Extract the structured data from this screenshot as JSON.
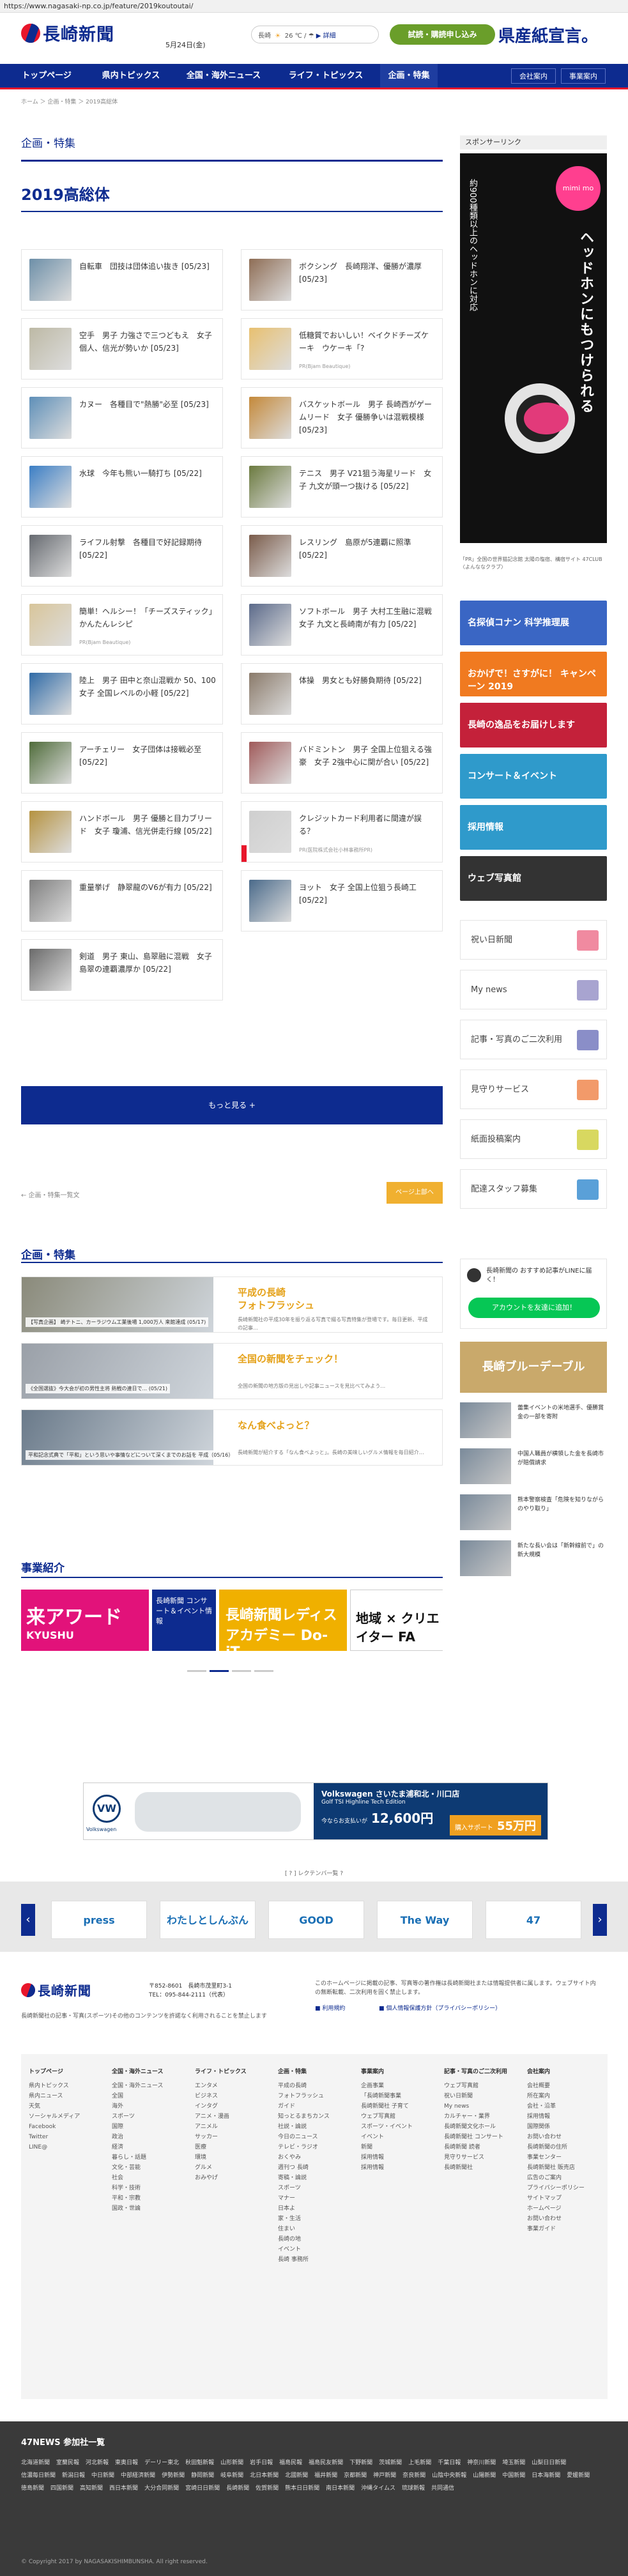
{
  "url": "https://www.nagasaki-np.co.jp/feature/2019koutoutai/",
  "header": {
    "logo_text": "長崎新聞",
    "date": "5月24日(金)",
    "weather_label": "長崎",
    "weather_temp": "26 ℃",
    "weather_sep": "/",
    "weather_more": "▶ 詳細",
    "trial_label": "試読・購読申し込み",
    "promo": "県産紙宣言。"
  },
  "nav": {
    "items": [
      "トップページ",
      "県内トピックス",
      "全国・海外ニュース",
      "ライフ・トピックス",
      "企画・特集"
    ],
    "active": "企画・特集",
    "right_links": [
      "会社案内",
      "事業案内"
    ]
  },
  "breadcrumb": "ホーム ＞ 企画・特集 ＞ 2019高総体",
  "section_title": "企画・特集",
  "page_title": "2019高総体",
  "articles": [
    {
      "title": "自転車　団技は団体追い抜き",
      "date": "[05/23]",
      "color": "#6d8fa8"
    },
    {
      "title": "ボクシング　長崎翔洋、優勝が濃厚",
      "date": "[05/23]",
      "color": "#8e6d55"
    },
    {
      "title": "空手　男子 力強さで三つどもえ　女子個人、信光が勢いか",
      "date": "[05/23]",
      "color": "#bdb9a5"
    },
    {
      "title": "低糖質でおいしい！ベイクドチーズケーキ　ウケーキ「?",
      "date": "",
      "sub": "PR(Bjam Beautique)",
      "color": "#e8c070"
    },
    {
      "title": "カヌー　各種目で\"熱勝\"必至",
      "date": "[05/23]",
      "color": "#5e8fb8"
    },
    {
      "title": "バスケットボール　男子 長崎西がゲームリード　女子 優勝争いは混戦模様",
      "date": "[05/23]",
      "color": "#c4893a"
    },
    {
      "title": "水球　今年も熊い一騎打ち",
      "date": "[05/22]",
      "color": "#3b7ec5"
    },
    {
      "title": "テニス　男子 V21狙う海星リード　女子 九文が頭一つ抜ける",
      "date": "[05/22]",
      "color": "#6b7a3f"
    },
    {
      "title": "ライフル射撃　各種目で好記録期待",
      "date": "[05/22]",
      "color": "#666a70"
    },
    {
      "title": "レスリング　島原が5連覇に照準",
      "date": "[05/22]",
      "color": "#7a5b4a"
    },
    {
      "title": "簡単！ヘルシー！「チーズスティック」かんたんレシピ",
      "date": "",
      "sub": "PR(Bjam Beautique)",
      "color": "#d8c59a"
    },
    {
      "title": "ソフトボール　男子 大村工生融に混戦女子 九文と長崎南が有力",
      "date": "[05/22]",
      "color": "#5b6a8a"
    },
    {
      "title": "陸上　男子 田中と奈山混戦か 50、100　女子 全国レベルの小軽",
      "date": "[05/22]",
      "color": "#2f6aa6"
    },
    {
      "title": "体操　男女とも好勝負期待",
      "date": "[05/22]",
      "color": "#8a7a6a"
    },
    {
      "title": "アーチェリー　女子団体は接戦必至",
      "date": "[05/22]",
      "color": "#4f6c3a"
    },
    {
      "title": "バドミントン　男子 全国上位狙える強豪　女子 2強中心に関が合い",
      "date": "[05/22]",
      "color": "#a05a5a"
    },
    {
      "title": "ハンドボール　男子 優勝と目力ブリード　女子 瓊浦、信光併走行線",
      "date": "[05/22]",
      "color": "#b59240"
    },
    {
      "title": "クレジットカード利用者に間違が誤る？",
      "date": "",
      "sub": "PR(医院株式会社小林事務所PR)",
      "color": "#cfcfcf",
      "pr": true
    },
    {
      "title": "重量挙げ　静翠龍のV6が有力",
      "date": "[05/22]",
      "color": "#7f7f7f"
    },
    {
      "title": "ヨット　女子 全国上位狙う長崎工",
      "date": "[05/22]",
      "color": "#4a6a8a"
    },
    {
      "title": "剣道　男子 東山、島翠融に混戦　女子 島翠の連覇濃厚か",
      "date": "[05/22]",
      "color": "#6a6a6a"
    }
  ],
  "more_button": "もっと見る +",
  "pager": {
    "prev": "← 企画・特集一覧文",
    "top": "ページ上部へ"
  },
  "feature_section": "企画・特集",
  "features": [
    {
      "caption": "【写真企画】 崎テトニ、カーラジウム工業後場 1,000万人 来館達成 (05/17)",
      "title1": "平成の長崎",
      "title2": "フォトフラッシュ",
      "desc": "長崎新聞社の平成30年を振り返る写真で綴る写真特集が登場です。毎日更新、平成の記事…",
      "color": "#8a8a7a"
    },
    {
      "caption": "《全国選抜》今大会が初の男性主将 熱戦の連日で... (05/21)",
      "title1": "全国の新聞をチェック！",
      "title2": "",
      "desc": "全国の新聞の地方版の見出しや記事ニュースを見比べてみよう…",
      "color": "#9aa0a8"
    },
    {
      "caption": "平和記念式典で「平和」という思いや事情などについて深くまでのお話を 平成（05/16）",
      "title1": "なん食べよっと？",
      "title2": "",
      "desc": "長崎新聞が紹介する「なん食べよっと」。長崎の美味しいグルメ情報を毎日紹介…",
      "color": "#6a7a8a"
    }
  ],
  "business_section": "事業紹介",
  "business_banners": [
    "来アワード",
    "KYUSHU",
    "長崎新聞 コンサート＆イベント情報",
    "長崎新聞レディスアカデミー Do-iT",
    "地域 × クリエイター FA"
  ],
  "sidebar": {
    "sponsor_label": "スポンサーリンク",
    "headphone_title": "ヘッドホンにもつけられる",
    "headphone_brand": "mimi mo",
    "headphone_text": "約900種類以上のヘッドホンに対応",
    "ad_note": "「PR」全国の世界猫記念館 太陽の塩宿、構宿サイト 47CLUB 〈よんななクラブ〉",
    "ad_items": [
      "名探偵コナン 科学推理展",
      "おかげで！さすがに！ キャンペーン 2019",
      "長崎の逸品をお届けします",
      "コンサート＆イベント",
      "採用情報",
      "ウェブ写真館"
    ],
    "buttons": [
      {
        "label": "祝い日新聞",
        "color": "#f08aa0"
      },
      {
        "label": "My news",
        "color": "#a8a4d0"
      },
      {
        "label": "記事・写真のご二次利用",
        "color": "#8a8ec8"
      },
      {
        "label": "見守りサービス",
        "color": "#f29a6a"
      },
      {
        "label": "紙面投稿案内",
        "color": "#d8d860"
      },
      {
        "label": "配達スタッフ募集",
        "color": "#5aa0d8"
      }
    ],
    "line_title": "長崎新聞の おすすめ記事がLINEに届く！",
    "line_button": "アカウントを友達に追加！",
    "mini_ad": "長崎ブルーデーブル",
    "side_news": [
      "蕾集イベントの米地選手、優勝賞金の一部を寄附",
      "中国人職員が横領した金を長崎市が賠償請求",
      "熊本警察検査「危険を知りながらのやり取り」",
      "新たな長い会は「新幹線前で」の新大規模"
    ]
  },
  "vw_ad": {
    "brand": "Volkswagen",
    "dealer": "Volkswagen さいたま浦和北・川口店",
    "model": "Golf TSI Highline Tech Edition",
    "price_label": "今ならお支払いが",
    "price": "12,600円",
    "purchase": "購入サポート",
    "support_amount": "55万円"
  },
  "ad_note_bottom": "[ ? ] レクテンバ一覧 ?",
  "sponsor_logos": [
    "press",
    "わたしとしんぶん",
    "GOOD",
    "The Way",
    "47"
  ],
  "footer": {
    "logo": "長崎新聞",
    "address": "〒852-8601　長崎市茂里町3-1",
    "tel": "TEL：095-844-2111（代表）",
    "copyright_line": "長崎新聞社の記事・写真(スポーツ)その他のコンテンツを許諾なく利用されることを禁止します",
    "notice": "このホームページに掲載の記事、写真等の著作権は長崎新聞社または情報提供者に属します。ウェブサイト内の無断転載、二次利用を固く禁止します。",
    "links_top": [
      "■ 利用規約",
      "■ 個人情報保護方針（プライバシーポリシー）"
    ],
    "cols": [
      {
        "title": "トップページ",
        "items": [
          "県内トピックス",
          "県内ニュース",
          "天気",
          "ソーシャルメディア",
          "Facebook",
          "Twitter",
          "LINE@"
        ]
      },
      {
        "title": "全国・海外ニュース",
        "items": [
          "全国・海外ニュース",
          "全国",
          "海外",
          "スポーツ",
          "国際",
          "政治",
          "経済",
          "暮らし・話題",
          "文化・芸能",
          "社会",
          "科学・技術",
          "平和・宗教",
          "国政・世論"
        ]
      },
      {
        "title": "ライフ・トピックス",
        "items": [
          "エンタメ",
          "ビジネス",
          "インタグ",
          "アニメ・漫画",
          "アニメル",
          "サッカー",
          "医療",
          "環境",
          "グルメ",
          "おみやげ"
        ]
      },
      {
        "title": "企画・特集",
        "items": [
          "平成の長崎",
          "フォトフラッシュ",
          "ガイド",
          "知っとるまちカンス",
          "社説・論説",
          "今日のニュース",
          "テレビ・ラジオ",
          "おくやみ",
          "週刊つ 長崎",
          "寄稿・論説",
          "スポーツ",
          "マナー",
          "日本よ",
          "家・生活",
          "住まい",
          "長崎の地",
          "イベント",
          "長崎 事務所"
        ]
      },
      {
        "title": "事業案内",
        "items": [
          "企画事業",
          "「長崎新聞事業",
          "長崎新聞社 子育て",
          "ウェブ写真館",
          "スポーツ・イベント",
          "イベント",
          "新聞",
          "採用情報",
          "採用情報"
        ]
      },
      {
        "title": "記事・写真のご二次利用",
        "items": [
          "ウェブ写真館",
          "祝い日新聞",
          "My news",
          "カルチャー・業界",
          "長崎新聞文化ホール",
          "長崎新聞社 コンサート",
          "長崎新聞 読者",
          "見守りサービス",
          "長崎新聞社"
        ]
      },
      {
        "title": "会社案内",
        "items": [
          "会社概要",
          "所在案内",
          "会社・沿革",
          "採用情報",
          "国際関係",
          "お問い合わせ",
          "長崎新聞の住所",
          "事業センター",
          "長崎新聞社 販売店",
          "広告のご案内",
          "プライバシーポリシー",
          "サイトマップ",
          "ホームページ",
          "お問い合わせ",
          "事業ガイド"
        ]
      }
    ]
  },
  "f47": {
    "title": "47NEWS 参加社一覧",
    "papers": [
      "北海道新聞",
      "室蘭民報",
      "河北新報",
      "東奥日報",
      "デーリー東北",
      "秋田魁新報",
      "山形新聞",
      "岩手日報",
      "福島民報",
      "福島民友新聞",
      "下野新聞",
      "茨城新聞",
      "上毛新聞",
      "千葉日報",
      "神奈川新聞",
      "埼玉新聞",
      "山梨日日新聞",
      "信濃毎日新聞",
      "新潟日報",
      "中日新聞",
      "中部経済新聞",
      "伊勢新聞",
      "静岡新聞",
      "岐阜新聞",
      "北日本新聞",
      "北國新聞",
      "福井新聞",
      "京都新聞",
      "神戸新聞",
      "奈良新聞",
      "山陰中央新報",
      "山陽新聞",
      "中国新聞",
      "日本海新聞",
      "愛媛新聞",
      "徳島新聞",
      "四国新聞",
      "高知新聞",
      "西日本新聞",
      "大分合同新聞",
      "宮崎日日新聞",
      "長崎新聞",
      "佐賀新聞",
      "熊本日日新聞",
      "南日本新聞",
      "沖縄タイムス",
      "琉球新報",
      "共同通信"
    ],
    "copyright": "© Copyright 2017 by NAGASAKISHIMBUNSHA. All right reserved."
  },
  "colors": {
    "brand_blue": "#0d2b8f",
    "brand_red": "#e8162b",
    "accent_yellow": "#e5a21a",
    "line_green": "#06c755"
  }
}
